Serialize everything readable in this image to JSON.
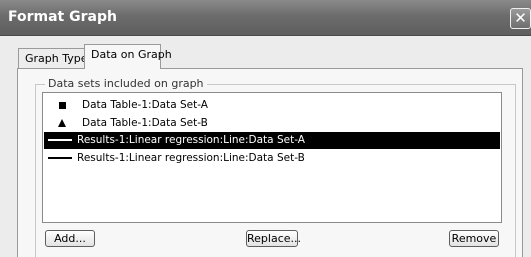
{
  "window": {
    "title": "Format Graph",
    "close_glyph": "✕"
  },
  "tabs": [
    {
      "label": "Graph Type"
    },
    {
      "label": "Data on Graph"
    }
  ],
  "groupbox": {
    "label": "Data sets included on graph"
  },
  "datasets": [
    {
      "marker": "square-icon",
      "label": "Data Table-1:Data Set-A",
      "selected": false
    },
    {
      "marker": "triangle-icon",
      "label": "Data Table-1:Data Set-B",
      "selected": false
    },
    {
      "marker": "line-icon",
      "label": "Results-1:Linear regression:Line:Data Set-A",
      "selected": true
    },
    {
      "marker": "line-icon",
      "label": "Results-1:Linear regression:Line:Data Set-B",
      "selected": false
    }
  ],
  "buttons": {
    "add": "Add...",
    "replace": "Replace...",
    "remove": "Remove"
  }
}
